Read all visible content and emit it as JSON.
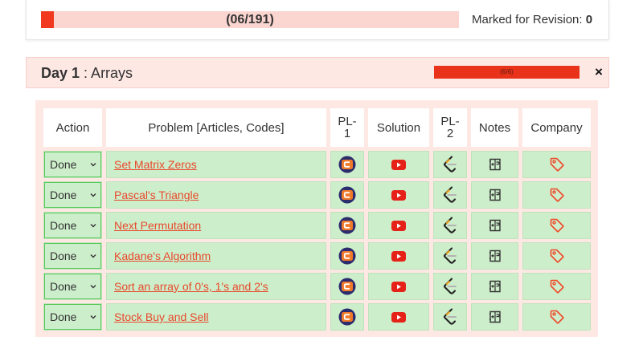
{
  "progress": {
    "label": "(06/191)",
    "done": 6,
    "total": 191,
    "fraction": 0.0314,
    "revision_label": "Marked for Revision: ",
    "revision_count": "0"
  },
  "day": {
    "title_bold": "Day 1",
    "title_rest": " : Arrays",
    "progress_label": "(6/6)",
    "progress_fraction": 1.0,
    "close_glyph": "×"
  },
  "table": {
    "headers": {
      "action": "Action",
      "problem": "Problem [Articles, Codes]",
      "pl1": "PL- 1",
      "solution": "Solution",
      "pl2": "PL- 2",
      "notes": "Notes",
      "company": "Company"
    },
    "rows": [
      {
        "action": "Done",
        "problem": "Set Matrix Zeros"
      },
      {
        "action": "Done",
        "problem": "Pascal's Triangle"
      },
      {
        "action": "Done",
        "problem": "Next Permutation"
      },
      {
        "action": "Done",
        "problem": "Kadane's Algorithm"
      },
      {
        "action": "Done",
        "problem": "Sort an array of 0's, 1's and 2's"
      },
      {
        "action": "Done",
        "problem": "Stock Buy and Sell"
      }
    ],
    "icons": {
      "pl1": "coding-ninjas-icon",
      "solution": "youtube-icon",
      "pl2": "leetcode-icon",
      "notes": "notes-icon",
      "company": "tag-icon"
    }
  },
  "colors": {
    "accent": "#f0391f",
    "progress_track": "#fbd5d0",
    "done_row": "#cdeecb",
    "link": "#e8492c",
    "panel": "#fde8e4"
  }
}
